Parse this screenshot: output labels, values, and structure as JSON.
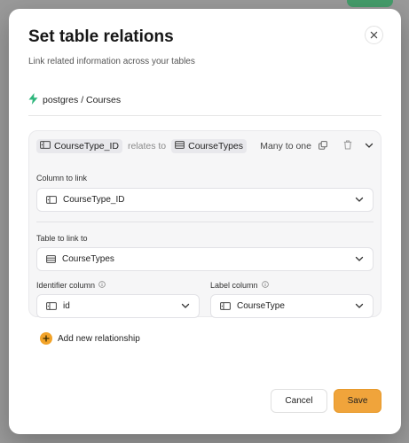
{
  "modal": {
    "title": "Set table relations",
    "subtitle": "Link related information across your tables",
    "close_icon": "close-icon"
  },
  "source": {
    "icon": "lightning-icon",
    "icon_color": "#2fb67c",
    "path": "postgres / Courses"
  },
  "relation": {
    "from_column": "CourseType_ID",
    "relates_text": "relates to",
    "to_table": "CourseTypes",
    "cardinality": "Many to one",
    "column_to_link": {
      "label": "Column to link",
      "value": "CourseType_ID"
    },
    "table_to_link": {
      "label": "Table to link to",
      "value": "CourseTypes"
    },
    "identifier_column": {
      "label": "Identifier column",
      "value": "id"
    },
    "label_column": {
      "label": "Label column",
      "value": "CourseType"
    }
  },
  "add_relationship": {
    "label": "Add new relationship",
    "accent": "#f2a329"
  },
  "footer": {
    "cancel_label": "Cancel",
    "save_label": "Save",
    "save_color": "#f0a43b"
  }
}
